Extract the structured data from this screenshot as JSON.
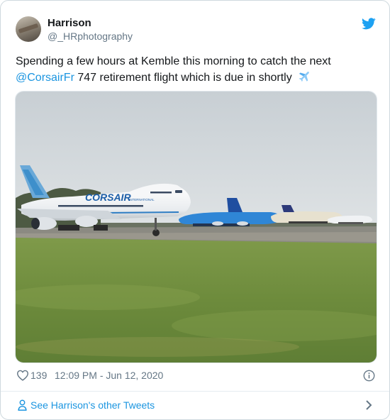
{
  "author": {
    "display_name": "Harrison",
    "handle": "@_HRphotography",
    "avatar_icon": "profile-photo-avatar"
  },
  "tweet": {
    "text_line1": "Spending a few hours at Kemble this morning to catch the next",
    "mention": "@CorsairFr",
    "text_line2_rest": " 747 retirement flight which is due in shortly",
    "emoji": "airplane-emoji"
  },
  "media": {
    "aircraft_livery_text": "CORSAIR",
    "aircraft_subtext": "INTERNATIONAL"
  },
  "meta": {
    "like_count": "139",
    "timestamp": "12:09 PM - Jun 12, 2020"
  },
  "footer": {
    "link_label": "See Harrison's other Tweets"
  },
  "colors": {
    "link": "#1b95e0",
    "secondary_text": "#657786",
    "twitter_brand": "#1da1f2"
  }
}
